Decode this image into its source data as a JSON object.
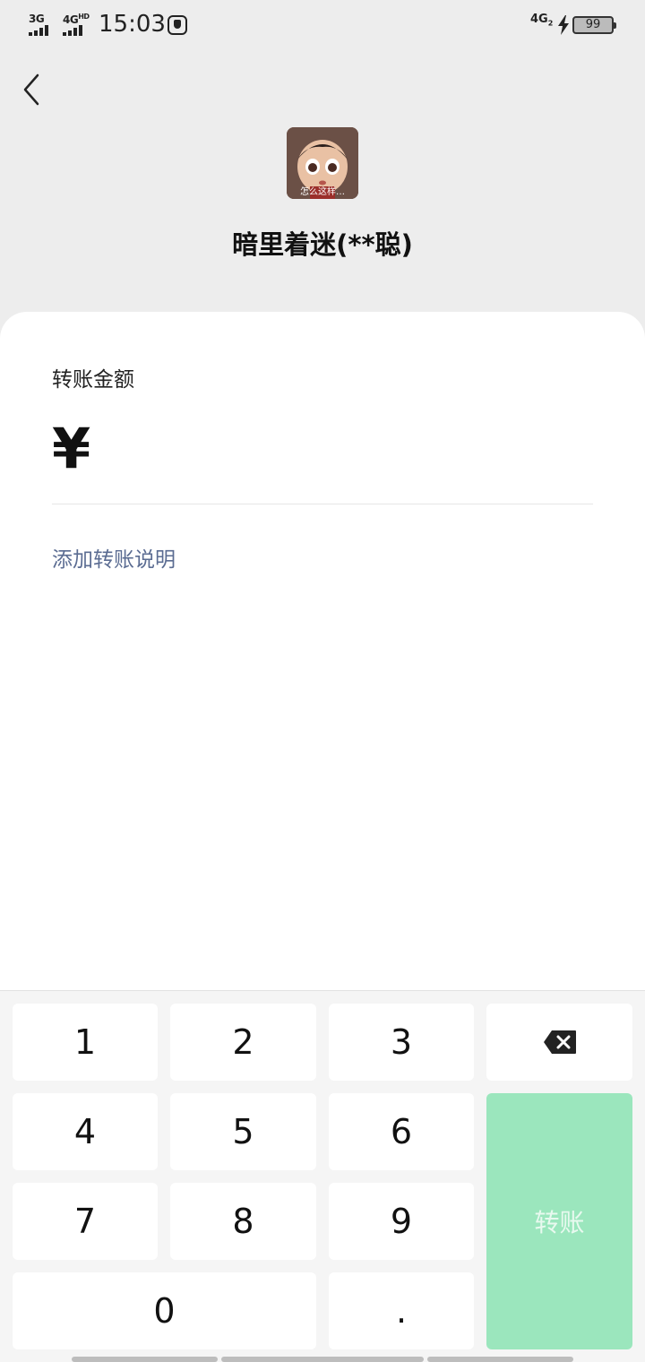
{
  "status_bar": {
    "sim1": "3G",
    "sim2": "4G",
    "sim2_badge": "HD",
    "time": "15:03",
    "network_right": "4G",
    "network_right_sub": "2",
    "battery": "99"
  },
  "payee": {
    "avatar_caption": "怎么这样…",
    "name": "暗里着迷(**聪)"
  },
  "form": {
    "amount_label": "转账金额",
    "currency_symbol": "¥",
    "add_note": "添加转账说明"
  },
  "keypad": {
    "keys": [
      "1",
      "2",
      "3",
      "4",
      "5",
      "6",
      "7",
      "8",
      "9",
      "0",
      "."
    ],
    "transfer_label": "转账"
  },
  "colors": {
    "accent_green": "#9be6bd",
    "link_blue": "#5b6c92"
  },
  "icons": [
    "back-icon",
    "backspace-icon",
    "bolt-icon",
    "hand-icon"
  ]
}
